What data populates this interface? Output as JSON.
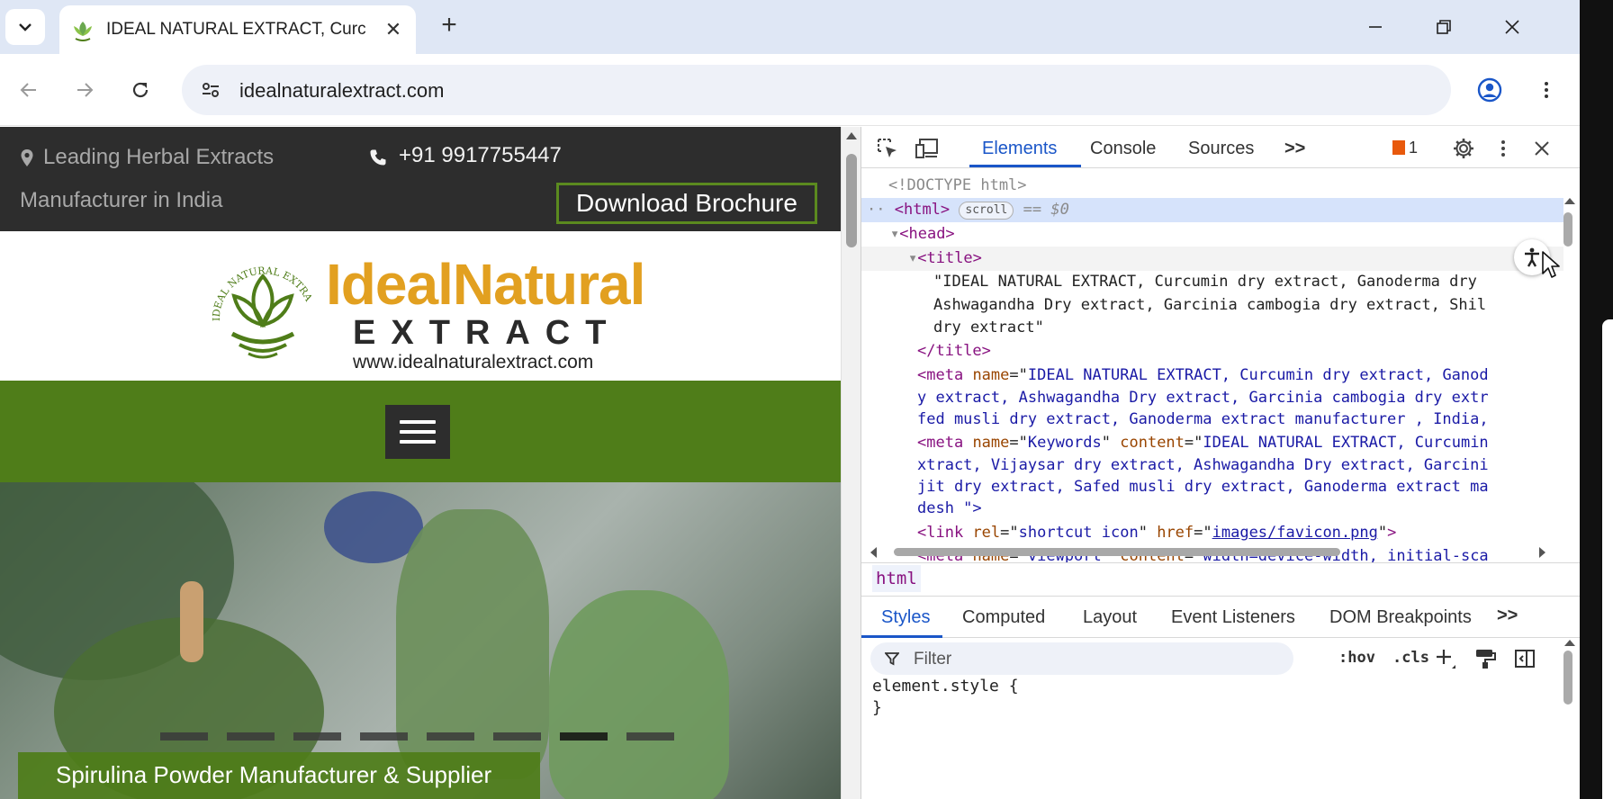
{
  "browser": {
    "tab_title": "IDEAL NATURAL EXTRACT, Curc",
    "url": "idealnaturalextract.com"
  },
  "page": {
    "tagline_1": "Leading Herbal Extracts",
    "tagline_2": "Manufacturer in India",
    "phone": "+91 9917755447",
    "brochure_label": "Download Brochure",
    "logo_ideal": "IdealNatural",
    "logo_extract": "EXTRACT",
    "logo_url": "www.idealnaturalextract.com",
    "logo_ring_text": "IDEAL NATURAL EXTRACT",
    "hero_caption": "Spirulina Powder Manufacturer & Supplier",
    "hero_slide_count": 8,
    "hero_active_slide": 7
  },
  "devtools": {
    "tabs": [
      "Elements",
      "Console",
      "Sources"
    ],
    "more_tabs": ">>",
    "issues_count": "1",
    "dom": {
      "doctype": "<!DOCTYPE html>",
      "html_tag": "<html>",
      "scroll_badge": "scroll",
      "selected_ref": "== $0",
      "head_tag": "<head>",
      "title_open": "<title>",
      "title_text_1": "\"IDEAL NATURAL EXTRACT, Curcumin dry extract, Ganoderma dry",
      "title_text_2": "Ashwagandha Dry extract, Garcinia cambogia dry extract, Shil",
      "title_text_3": "dry extract\"",
      "title_close": "</title>",
      "meta1_lines": [
        "IDEAL NATURAL EXTRACT, Curcumin dry extract, Ganod",
        "y extract, Ashwagandha Dry extract, Garcinia cambogia dry extr",
        "fed musli dry extract, Ganoderma extract manufacturer , India,"
      ],
      "meta2_content_1": "IDEAL NATURAL EXTRACT, Curcumin",
      "meta2_lines": [
        "xtract, Vijaysar dry extract, Ashwagandha Dry extract, Garcini",
        "jit dry extract, Safed musli dry extract, Ganoderma extract ma",
        "desh  \">"
      ],
      "link_rel": "shortcut icon",
      "link_href": "images/favicon.png",
      "viewport_content": "width=device-width, initial-sca"
    },
    "breadcrumb": "html",
    "styles_tabs": [
      "Styles",
      "Computed",
      "Layout",
      "Event Listeners",
      "DOM Breakpoints"
    ],
    "filter_placeholder": "Filter",
    "hov_label": ":hov",
    "cls_label": ".cls",
    "element_style": "element.style {",
    "element_style_close": "}"
  },
  "colors": {
    "brand_green": "#4f7d19",
    "brand_orange": "#e2a020",
    "devtools_accent": "#1a56c8"
  }
}
